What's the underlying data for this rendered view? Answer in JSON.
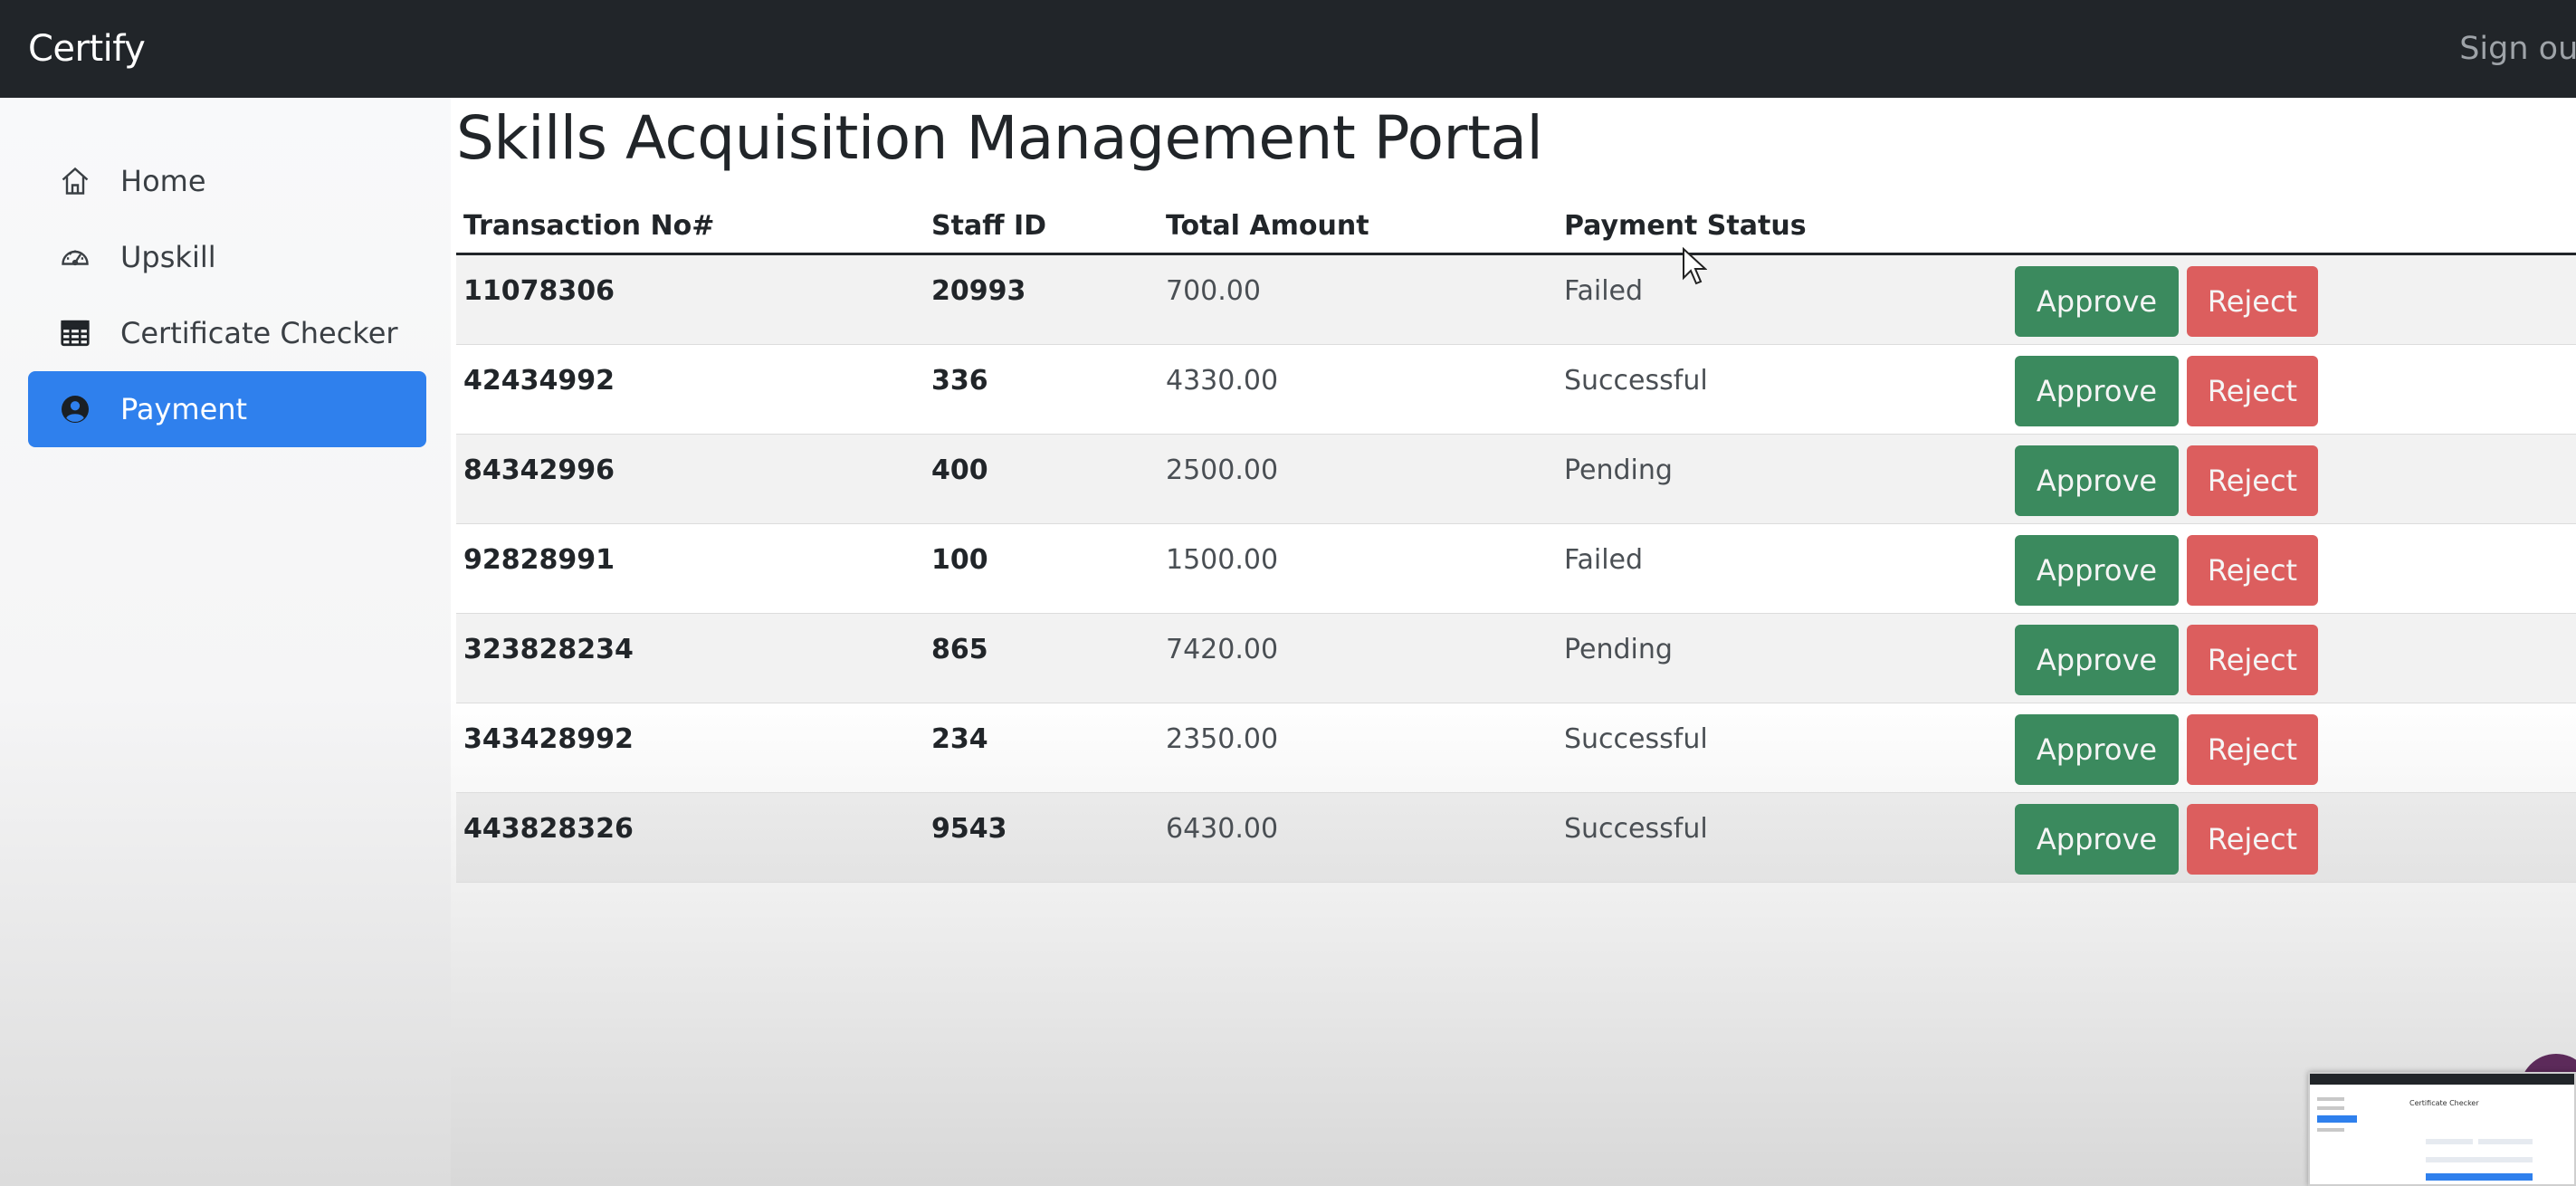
{
  "app": {
    "brand": "Certify",
    "sign_out": "Sign out"
  },
  "sidebar": {
    "items": [
      {
        "label": "Home",
        "icon": "home-icon",
        "active": false
      },
      {
        "label": "Upskill",
        "icon": "speedometer-icon",
        "active": false
      },
      {
        "label": "Certificate Checker",
        "icon": "table-icon",
        "active": false
      },
      {
        "label": "Payment",
        "icon": "user-circle-icon",
        "active": true
      }
    ]
  },
  "main": {
    "title": "Skills Acquisition Management Portal",
    "table": {
      "headers": [
        "Transaction No#",
        "Staff ID",
        "Total Amount",
        "Payment Status"
      ],
      "rows": [
        {
          "transaction": "11078306",
          "staff_id": "20993",
          "amount": "700.00",
          "status": "Failed"
        },
        {
          "transaction": "42434992",
          "staff_id": "336",
          "amount": "4330.00",
          "status": "Successful"
        },
        {
          "transaction": "84342996",
          "staff_id": "400",
          "amount": "2500.00",
          "status": "Pending"
        },
        {
          "transaction": "92828991",
          "staff_id": "100",
          "amount": "1500.00",
          "status": "Failed"
        },
        {
          "transaction": "323828234",
          "staff_id": "865",
          "amount": "7420.00",
          "status": "Pending"
        },
        {
          "transaction": "343428992",
          "staff_id": "234",
          "amount": "2350.00",
          "status": "Successful"
        },
        {
          "transaction": "443828326",
          "staff_id": "9543",
          "amount": "6430.00",
          "status": "Successful"
        }
      ],
      "approve_label": "Approve",
      "reject_label": "Reject"
    }
  },
  "thumbnail": {
    "title": "Certificate Checker"
  },
  "colors": {
    "topbar": "#212529",
    "active_nav": "#2f80ed",
    "approve": "#3b8a5e",
    "reject": "#dc5e5e"
  }
}
